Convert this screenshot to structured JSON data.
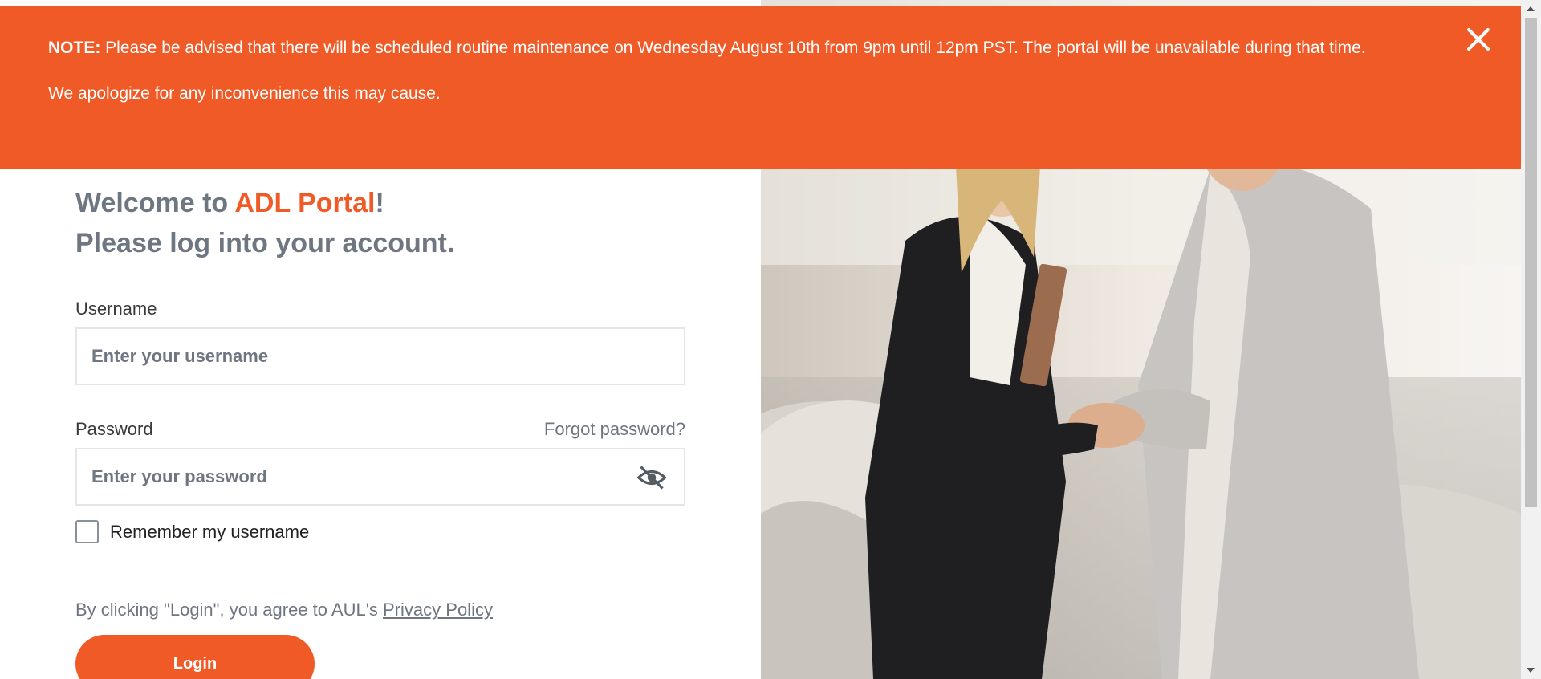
{
  "banner": {
    "note_label": "NOTE:",
    "message": "Please be advised that there will be scheduled routine maintenance on  Wednesday August 10th from 9pm until 12pm PST. The portal will be unavailable during that time.",
    "apology": "We apologize for any inconvenience this may cause.",
    "close_icon": "close-icon",
    "color": "#ef5a27"
  },
  "login": {
    "welcome_prefix": "Welcome to ",
    "brand_name": "ADL Portal",
    "welcome_suffix": "!",
    "subtitle": "Please log into your account.",
    "username_label": "Username",
    "username_placeholder": "Enter your username",
    "username_value": "",
    "password_label": "Password",
    "forgot_password": "Forgot password?",
    "password_placeholder": "Enter your password",
    "password_value": "",
    "password_toggle_icon": "eye-slash-icon",
    "remember_label": "Remember my username",
    "remember_checked": false,
    "terms_prefix": "By clicking \"Login\", you agree to AUL's ",
    "privacy_link": "Privacy Policy",
    "login_button": "Login",
    "accent_color": "#ef5a27",
    "text_color": "#6e7681"
  }
}
